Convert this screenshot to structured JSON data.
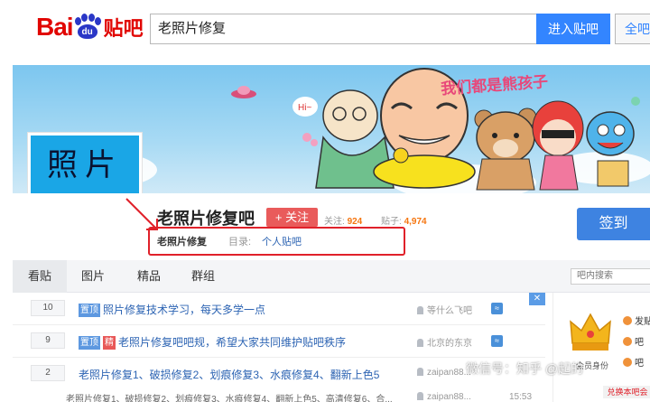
{
  "header": {
    "logo_text_bai": "Bai",
    "logo_text_du": "du",
    "logo_text_tieba": "贴吧",
    "search_value": "老照片修复",
    "enter_button": "进入贴吧",
    "all_button": "全吧"
  },
  "banner": {
    "slogan": "我们都是熊孩子"
  },
  "forum": {
    "avatar_text": "照片",
    "title": "老照片修复吧",
    "follow_label": "+ 关注",
    "follow_count_label": "关注:",
    "follow_count": "924",
    "post_count_label": "贴子:",
    "post_count": "4,974",
    "sign_button": "签到",
    "sub_name": "老照片修复",
    "dir_label": "目录:",
    "dir_link": "个人贴吧"
  },
  "tabs": [
    {
      "label": "看贴"
    },
    {
      "label": "图片"
    },
    {
      "label": "精品"
    },
    {
      "label": "群组"
    }
  ],
  "inner_search_placeholder": "吧内搜索",
  "threads": [
    {
      "replies": "10",
      "tags": [
        "置顶"
      ],
      "title": "照片修复技术学习，每天多学一点",
      "author": "等什么飞吧"
    },
    {
      "replies": "9",
      "tags": [
        "置顶",
        "精"
      ],
      "title": "老照片修复吧吧规，希望大家共同维护贴吧秩序",
      "author": "北京的东京"
    },
    {
      "replies": "2",
      "tags": [],
      "title": "老照片修复1、破损修复2、划痕修复3、水痕修复4、翻新上色5",
      "author": "zaipan88..."
    }
  ],
  "thread_abstract": "老照片修复1、破损修复2、划痕修复3、水痕修复4、翻新上色5、高清修复6、合...",
  "thread_abstract_author": "zaipan88...",
  "thread_abstract_time": "15:53",
  "sidebar": {
    "items": [
      "发贴",
      "吧",
      "吧"
    ],
    "label": "会员身份",
    "red_button": "兑换本吧会"
  },
  "watermark": "微信号：知乎 @起的",
  "colors": {
    "brand_red": "#e10602",
    "brand_blue": "#3385ff",
    "link_blue": "#2d64b3",
    "highlight_red": "#e0212a",
    "count_orange": "#f5750f"
  }
}
